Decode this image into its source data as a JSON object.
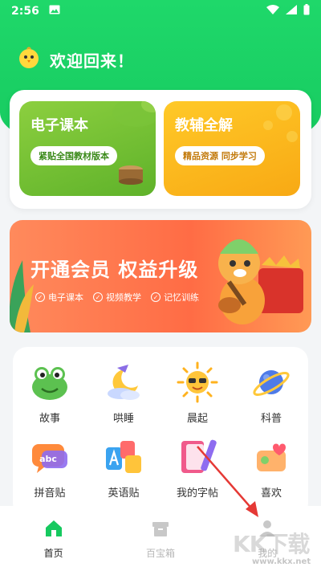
{
  "status_bar": {
    "time": "2:56",
    "icons": [
      "image-icon",
      "wifi-icon",
      "signal-icon",
      "battery-icon"
    ]
  },
  "header": {
    "avatar_icon": "chick-icon",
    "welcome": "欢迎回来！"
  },
  "feature_cards": [
    {
      "title": "电子课本",
      "pill": "紧贴全国教材版本",
      "color": "#6ec032"
    },
    {
      "title": "教辅全解",
      "pill": "精品资源 同步学习",
      "color": "#fbb61c"
    }
  ],
  "banner": {
    "title": "开通会员  权益升级",
    "features": [
      "电子课本",
      "视频教学",
      "记忆训练"
    ]
  },
  "grid": [
    {
      "label": "故事",
      "icon": "frog-icon"
    },
    {
      "label": "哄睡",
      "icon": "moon-icon"
    },
    {
      "label": "晨起",
      "icon": "sun-icon"
    },
    {
      "label": "科普",
      "icon": "planet-icon"
    },
    {
      "label": "拼音贴",
      "icon": "abc-bubble-icon"
    },
    {
      "label": "英语贴",
      "icon": "letters-icon"
    },
    {
      "label": "我的字帖",
      "icon": "copybook-icon"
    },
    {
      "label": "喜欢",
      "icon": "heart-icon"
    }
  ],
  "tab_bar": {
    "tabs": [
      {
        "label": "首页",
        "icon": "home-icon",
        "active": true
      },
      {
        "label": "百宝箱",
        "icon": "box-icon",
        "active": false
      },
      {
        "label": "我的",
        "icon": "profile-icon",
        "active": false
      }
    ]
  },
  "watermark": {
    "brand": "KK下载",
    "url": "www.kkx.net"
  },
  "colors": {
    "primary_green": "#1fd86a",
    "banner_orange": "#ff6c45",
    "tab_active": "#16c95f",
    "annotation_arrow": "#e53935"
  }
}
